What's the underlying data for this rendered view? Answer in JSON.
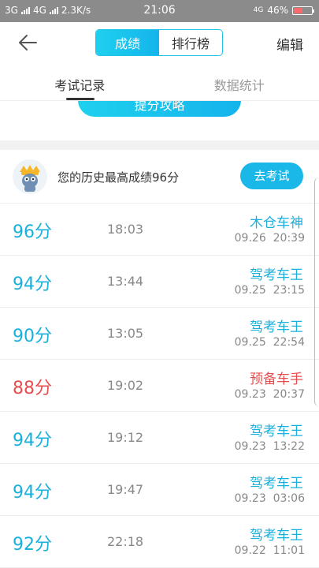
{
  "status": {
    "left_net1": "3G",
    "left_net2": "4G",
    "speed": "2.3K/s",
    "time": "21:06",
    "right_net": "4G",
    "battery": "46%"
  },
  "header": {
    "seg": [
      {
        "label": "成绩",
        "active": true
      },
      {
        "label": "排行榜",
        "active": false
      }
    ],
    "edit_label": "编辑"
  },
  "tabs": [
    {
      "label": "考试记录",
      "active": true
    },
    {
      "label": "数据统计",
      "active": false
    }
  ],
  "strategy_button": "提分攻略",
  "best": {
    "text": "您的历史最高成绩96分",
    "button": "去考试"
  },
  "records": [
    {
      "score": "96分",
      "duration": "18:03",
      "rank": "木仓车神",
      "date": "09.26",
      "time": "20:39",
      "highlight": false
    },
    {
      "score": "94分",
      "duration": "13:44",
      "rank": "驾考车王",
      "date": "09.25",
      "time": "23:15",
      "highlight": false
    },
    {
      "score": "90分",
      "duration": "13:05",
      "rank": "驾考车王",
      "date": "09.25",
      "time": "22:54",
      "highlight": false
    },
    {
      "score": "88分",
      "duration": "19:02",
      "rank": "预备车手",
      "date": "09.23",
      "time": "20:37",
      "highlight": true
    },
    {
      "score": "94分",
      "duration": "19:12",
      "rank": "驾考车王",
      "date": "09.23",
      "time": "13:22",
      "highlight": false
    },
    {
      "score": "94分",
      "duration": "19:47",
      "rank": "驾考车王",
      "date": "09.23",
      "time": "03:06",
      "highlight": false
    },
    {
      "score": "92分",
      "duration": "22:18",
      "rank": "驾考车王",
      "date": "09.22",
      "time": "11:01",
      "highlight": false
    }
  ],
  "colors": {
    "accent": "#1ab0dc",
    "warning": "#e84e4e"
  }
}
